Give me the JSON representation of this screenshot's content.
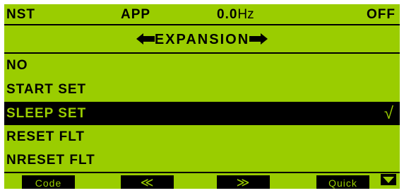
{
  "header": {
    "mode": "NST",
    "channel": "APP",
    "frequency_value": "0.0",
    "frequency_unit": "Hz",
    "status": "OFF"
  },
  "title": {
    "label": "EXPANSION",
    "left_icon": "left-arrow-icon",
    "right_icon": "right-arrow-icon"
  },
  "menu": {
    "items": [
      {
        "label": "NO"
      },
      {
        "label": "START SET"
      },
      {
        "label": "SLEEP SET",
        "selected": true,
        "check": "√"
      },
      {
        "label": "RESET FLT"
      },
      {
        "label": "NRESET FLT"
      }
    ]
  },
  "softkeys": {
    "code": "Code",
    "prev": "≪",
    "next": "≫",
    "quick": "Quick",
    "down_icon": "down-triangle-icon"
  },
  "colors": {
    "lcd_background": "#9acd00",
    "foreground": "#000000"
  }
}
